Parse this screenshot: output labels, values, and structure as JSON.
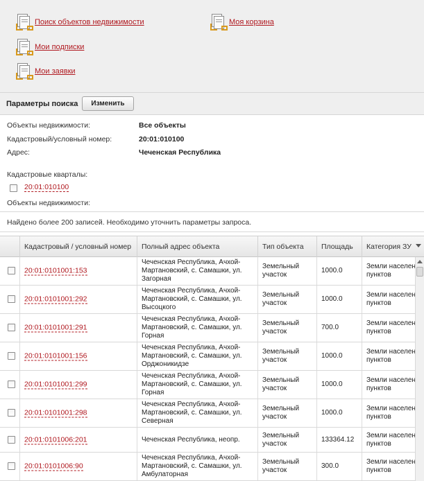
{
  "nav": {
    "search_objects": "Поиск объектов недвижимости",
    "cart": "Моя корзина",
    "subscriptions": "Мои подписки",
    "requests": "Мои заявки"
  },
  "params": {
    "title": "Параметры поиска",
    "change_button": "Изменить",
    "objects_label": "Объекты недвижимости:",
    "objects_value": "Все объекты",
    "cadastral_label": "Кадастровый/условный номер:",
    "cadastral_value": "20:01:010100",
    "address_label": "Адрес:",
    "address_value": "Чеченская Республика",
    "quarters_label": "Кадастровые кварталы:",
    "quarter_link": "20:01:010100",
    "objects_label2": "Объекты недвижимости:"
  },
  "result_message": "Найдено более 200 записей. Необходимо уточнить параметры запроса.",
  "table": {
    "columns": [
      "Кадастровый / условный номер",
      "Полный адрес объекта",
      "Тип объекта",
      "Площадь",
      "Категория ЗУ"
    ],
    "rows": [
      {
        "number": "20:01:0101001:153",
        "address": "Чеченская Республика, Ачхой-Мартановский, с. Самашки, ул. Загорная",
        "type": "Земельный участок",
        "area": "1000.0",
        "category": "Земли населенных пунктов"
      },
      {
        "number": "20:01:0101001:292",
        "address": "Чеченская Республика, Ачхой-Мартановский, с. Самашки, ул. Высоцкого",
        "type": "Земельный участок",
        "area": "1000.0",
        "category": "Земли населенных пунктов"
      },
      {
        "number": "20:01:0101001:291",
        "address": "Чеченская Республика, Ачхой-Мартановский, с. Самашки, ул. Горная",
        "type": "Земельный участок",
        "area": "700.0",
        "category": "Земли населенных пунктов"
      },
      {
        "number": "20:01:0101001:156",
        "address": "Чеченская Республика, Ачхой-Мартановский, с. Самашки, ул. Орджоникидзе",
        "type": "Земельный участок",
        "area": "1000.0",
        "category": "Земли населенных пунктов"
      },
      {
        "number": "20:01:0101001:299",
        "address": "Чеченская Республика, Ачхой-Мартановский, с. Самашки, ул. Горная",
        "type": "Земельный участок",
        "area": "1000.0",
        "category": "Земли населенных пунктов"
      },
      {
        "number": "20:01:0101001:298",
        "address": "Чеченская Республика, Ачхой-Мартановский, с. Самашки, ул. Северная",
        "type": "Земельный участок",
        "area": "1000.0",
        "category": "Земли населенных пунктов"
      },
      {
        "number": "20:01:0101006:201",
        "address": "Чеченская Республика, неопр.",
        "type": "Земельный участок",
        "area": "133364.12",
        "category": "Земли населенных пунктов"
      },
      {
        "number": "20:01:0101006:90",
        "address": "Чеченская Республика, Ачхой-Мартановский, с. Самашки, ул. Амбулаторная",
        "type": "Земельный участок",
        "area": "300.0",
        "category": "Земли населенных пунктов"
      }
    ]
  },
  "icons": {
    "nav_icon": "document-transfer-icon",
    "sort_icon": "chevron-down-icon",
    "checkbox": "checkbox-icon"
  },
  "colors": {
    "link": "#b0181f",
    "header_bg": "#efefef",
    "icon_accent": "#d99a1d"
  }
}
